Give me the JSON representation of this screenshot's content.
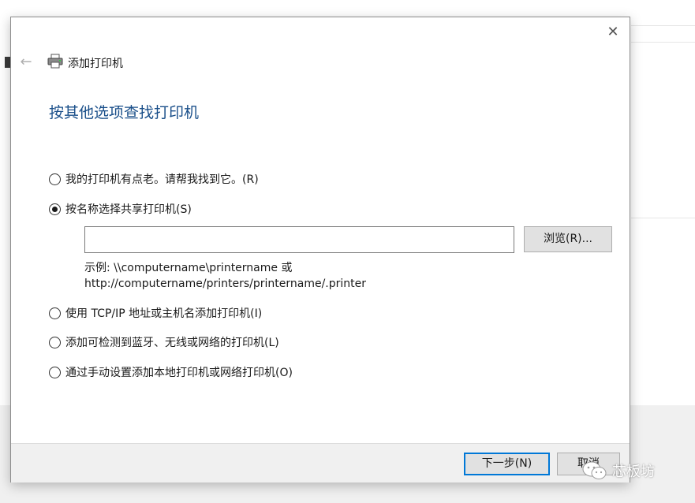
{
  "dialog": {
    "title": "添加打印机",
    "close_glyph": "✕",
    "back_glyph": "←",
    "heading": "按其他选项查找打印机"
  },
  "options": [
    {
      "label": "我的打印机有点老。请帮我找到它。(R)",
      "checked": false
    },
    {
      "label": "按名称选择共享打印机(S)",
      "checked": true
    },
    {
      "label": "使用 TCP/IP 地址或主机名添加打印机(I)",
      "checked": false
    },
    {
      "label": "添加可检测到蓝牙、无线或网络的打印机(L)",
      "checked": false
    },
    {
      "label": "通过手动设置添加本地打印机或网络打印机(O)",
      "checked": false
    }
  ],
  "share_input": {
    "value": "",
    "browse_label": "浏览(R)...",
    "example_line1": "示例: \\\\computername\\printername 或",
    "example_line2": "http://computername/printers/printername/.printer"
  },
  "footer": {
    "next_label": "下一步(N)",
    "cancel_label": "取消"
  },
  "watermark": {
    "text": "芯板坊"
  },
  "icons": {
    "back": "back-arrow-icon",
    "printer": "printer-icon",
    "close": "close-icon",
    "watermark": "wechat-icon"
  },
  "colors": {
    "heading": "#1a4f8a",
    "focus_border": "#0078d7"
  }
}
